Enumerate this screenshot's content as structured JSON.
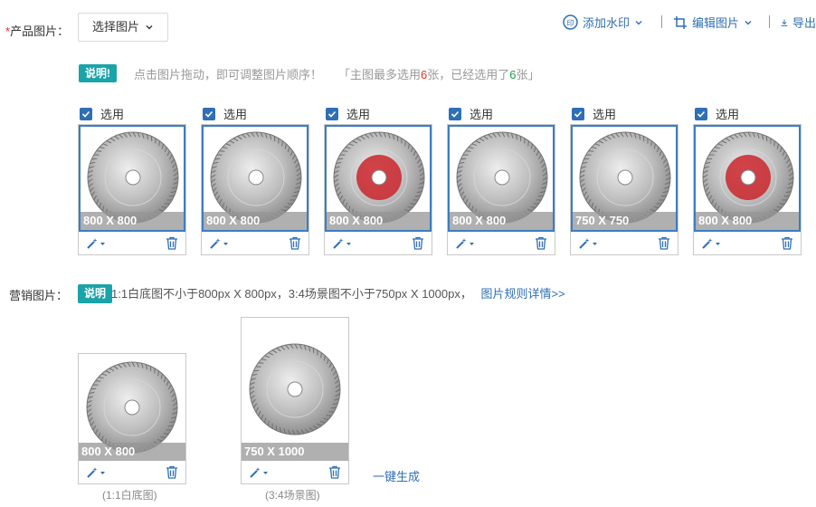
{
  "product": {
    "required_mark": "*",
    "label": "产品图片：",
    "select_button": "选择图片",
    "toolbar": {
      "watermark": "添加水印",
      "edit": "编辑图片",
      "export": "导出"
    },
    "tip_badge": "说明!",
    "tip_text": "点击图片拖动，即可调整图片顺序！",
    "tip_limit_prefix": "「主图最多选用",
    "tip_limit_max": "6",
    "tip_limit_mid": "张，已经选用了",
    "tip_limit_used": "6",
    "tip_limit_suffix": "张」",
    "check_label": "选用",
    "images": [
      {
        "size": "800 X 800"
      },
      {
        "size": "800 X 800"
      },
      {
        "size": "800 X 800"
      },
      {
        "size": "800 X 800"
      },
      {
        "size": "750 X 750"
      },
      {
        "size": "800 X 800"
      }
    ]
  },
  "marketing": {
    "label": "营销图片：",
    "badge": "说明",
    "rule_text": "1:1白底图不小于800px X 800px，3:4场景图不小于750px X 1000px，",
    "rule_link": "图片规则详情>>",
    "images": [
      {
        "size": "800 X 800",
        "caption": "(1:1白底图)"
      },
      {
        "size": "750 X 1000",
        "caption": "(3:4场景图)"
      }
    ],
    "generate_link": "一键生成"
  },
  "colors": {
    "accent": "#2f6fb5",
    "teal": "#1aa3a8",
    "highlight": "#e5341a"
  }
}
